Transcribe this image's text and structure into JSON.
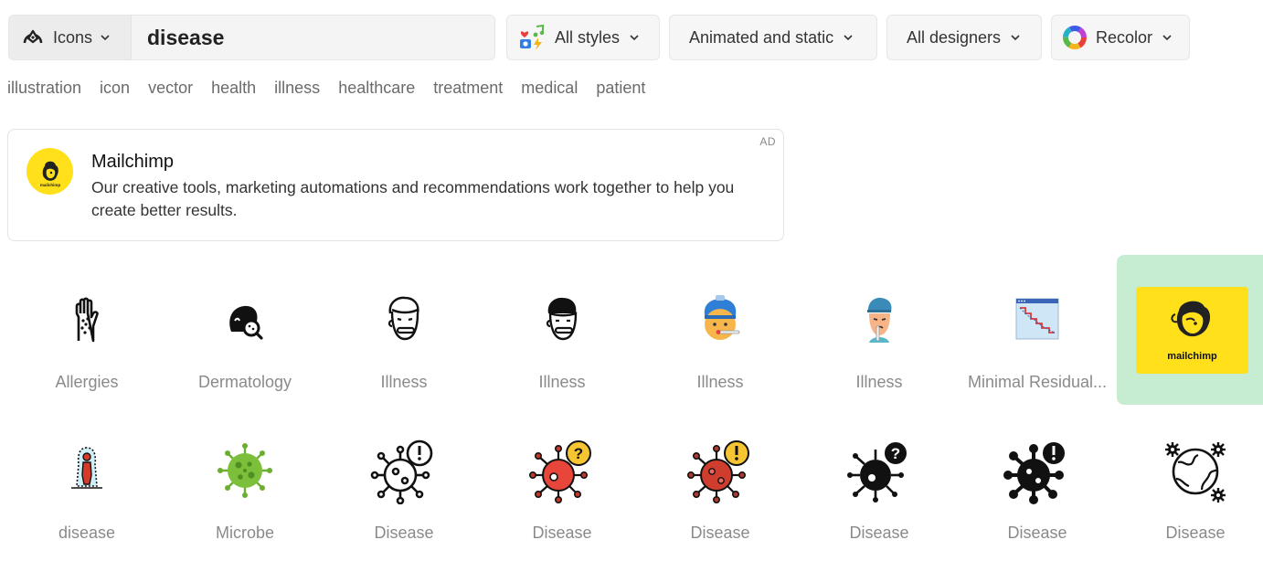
{
  "search": {
    "type_label": "Icons",
    "query": "disease"
  },
  "filters": {
    "styles": "All styles",
    "animation": "Animated and static",
    "designers": "All designers",
    "recolor": "Recolor"
  },
  "tags": [
    "illustration",
    "icon",
    "vector",
    "health",
    "illness",
    "healthcare",
    "treatment",
    "medical",
    "patient"
  ],
  "ad": {
    "title": "Mailchimp",
    "text": "Our creative tools, marketing automations and recommendations work together to help you create better results.",
    "badge": "AD",
    "logo_word": "mailchimp"
  },
  "sponsor": {
    "word": "mailchimp",
    "bg": "#c6ecd2",
    "card_color": "#ffe01b"
  },
  "icons_row1": [
    {
      "name": "Allergies",
      "icon": "allergy-hand-icon"
    },
    {
      "name": "Dermatology",
      "icon": "dermatology-face-icon"
    },
    {
      "name": "Illness",
      "icon": "sick-person-outline-icon"
    },
    {
      "name": "Illness",
      "icon": "sick-person-filled-icon"
    },
    {
      "name": "Illness",
      "icon": "sick-person-color-thermometer-icon"
    },
    {
      "name": "Illness",
      "icon": "sick-person-color-icon"
    },
    {
      "name": "Minimal Residual...",
      "icon": "declining-chart-window-icon"
    }
  ],
  "icons_row2": [
    {
      "name": "disease",
      "icon": "infected-person-icon"
    },
    {
      "name": "Microbe",
      "icon": "green-microbe-icon"
    },
    {
      "name": "Disease",
      "icon": "virus-alert-outline-icon"
    },
    {
      "name": "Disease",
      "icon": "virus-question-color-icon"
    },
    {
      "name": "Disease",
      "icon": "virus-alert-color-icon"
    },
    {
      "name": "Disease",
      "icon": "virus-question-glyph-icon"
    },
    {
      "name": "Disease",
      "icon": "virus-alert-glyph-icon"
    },
    {
      "name": "Disease",
      "icon": "globe-virus-gears-icon"
    }
  ]
}
